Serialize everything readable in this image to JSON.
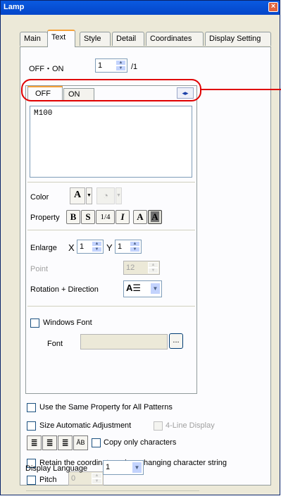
{
  "window": {
    "title": "Lamp",
    "close_icon": "close-icon"
  },
  "tabs": [
    {
      "label": "Main",
      "active": false
    },
    {
      "label": "Text",
      "active": true
    },
    {
      "label": "Style",
      "active": false
    },
    {
      "label": "Detail",
      "active": false
    },
    {
      "label": "Coordinates",
      "active": false
    },
    {
      "label": "Display Setting",
      "active": false
    }
  ],
  "offon": {
    "label": "OFF・ON",
    "value": "1",
    "suffix": "/1"
  },
  "state_tabs": {
    "off": "OFF",
    "on": "ON"
  },
  "text_area": {
    "value": "M100"
  },
  "color": {
    "label": "Color",
    "text_color_glyph": "A"
  },
  "property": {
    "label": "Property",
    "bold": "B",
    "shadow": "S",
    "quarter": "1/4",
    "italic": "I",
    "normal_a": "A",
    "reverse_a": "A"
  },
  "enlarge": {
    "label": "Enlarge",
    "x_label": "X",
    "x_value": "1",
    "y_label": "Y",
    "y_value": "1"
  },
  "point": {
    "label": "Point",
    "value": "12"
  },
  "rotation": {
    "label": "Rotation + Direction"
  },
  "windows_font": {
    "label": "Windows Font",
    "checked": false
  },
  "font": {
    "label": "Font",
    "value": "",
    "browse": "..."
  },
  "same_property": {
    "label": "Use the Same Property for All Patterns",
    "checked": false
  },
  "size_auto": {
    "label": "Size Automatic Adjustment",
    "checked": false
  },
  "four_line": {
    "label": "4-Line Display",
    "checked": false
  },
  "copy_only": {
    "label": "Copy only characters",
    "checked": false
  },
  "retain": {
    "label": "Retain the coordinates when changing character string",
    "checked": false
  },
  "pitch": {
    "label": "Pitch",
    "value": "0",
    "checked": false
  },
  "display_language": {
    "label": "Display Language",
    "value": "1"
  },
  "accent_colors": {
    "title_bar": "#0a5ae0",
    "highlight_ring": "#e00000",
    "tab_accent": "#f5a23a"
  }
}
